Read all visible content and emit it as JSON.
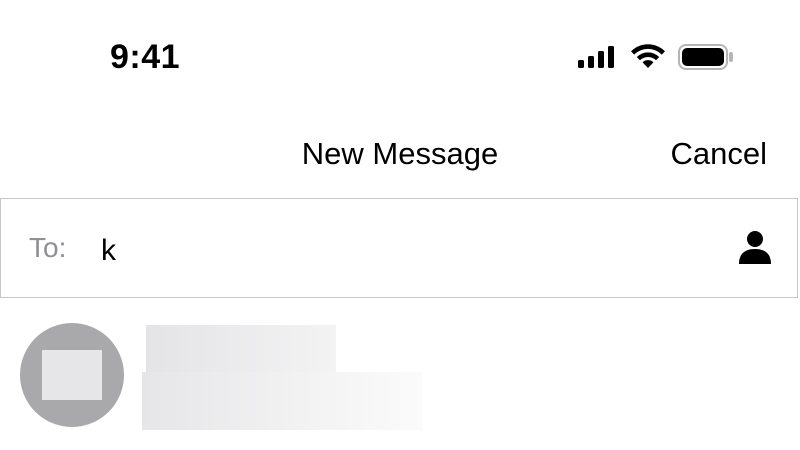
{
  "status_bar": {
    "time": "9:41",
    "icons": [
      "cellular-signal-icon",
      "wifi-icon",
      "battery-icon"
    ]
  },
  "nav": {
    "title": "New Message",
    "cancel_label": "Cancel"
  },
  "compose": {
    "to_label": "To:",
    "to_value": "k",
    "contact_icon": "person-icon"
  },
  "colors": {
    "label_gray": "#8e8e93",
    "border": "#c8c8cc",
    "avatar_bg": "#a9a9ab"
  }
}
